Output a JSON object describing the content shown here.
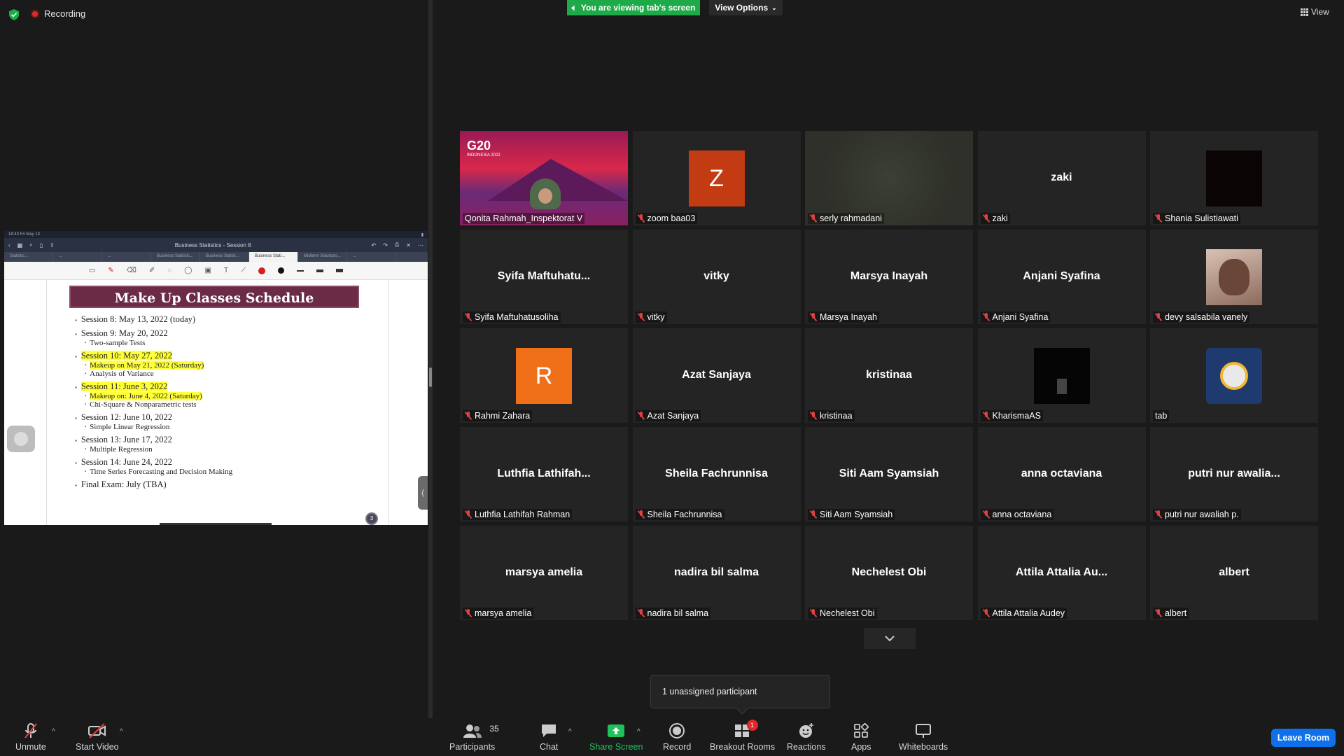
{
  "recording": {
    "label": "Recording"
  },
  "banner": {
    "viewing": "You are viewing tab's screen",
    "view_options": "View Options",
    "view": "View"
  },
  "shared": {
    "status_time": "18:43  Fri May 13",
    "doc_title": "Business Statistics - Session 8",
    "active_tab": "Business Stati...",
    "tabs": [
      "Statistic...",
      "...",
      "...",
      "Business Statistic...",
      "Business Statist...",
      "Business Stati...",
      "Midterm Solutions...",
      "..."
    ],
    "slide_title": "Make Up Classes Schedule",
    "items": [
      {
        "text": "Session 8: May 13, 2022 (today)",
        "highlight": false,
        "sub": []
      },
      {
        "text": "Session 9: May 20, 2022",
        "highlight": false,
        "sub": [
          {
            "text": "Two-sample Tests",
            "highlight": false
          }
        ]
      },
      {
        "text": "Session 10: May 27, 2022",
        "highlight": true,
        "sub": [
          {
            "text": "Makeup on May 21, 2022 (Saturday)",
            "highlight": true
          },
          {
            "text": "Analysis of Variance",
            "highlight": false
          }
        ]
      },
      {
        "text": "Session 11: June 3, 2022",
        "highlight": true,
        "sub": [
          {
            "text": "Makeup on: June 4, 2022 (Saturday)",
            "highlight": true
          },
          {
            "text": "Chi-Square & Nonparametric tests",
            "highlight": false
          }
        ]
      },
      {
        "text": "Session 12: June 10, 2022",
        "highlight": false,
        "sub": [
          {
            "text": "Simple Linear Regression",
            "highlight": false
          }
        ]
      },
      {
        "text": "Session 13: June 17, 2022",
        "highlight": false,
        "sub": [
          {
            "text": "Multiple Regression",
            "highlight": false
          }
        ]
      },
      {
        "text": "Session 14: June 24, 2022",
        "highlight": false,
        "sub": [
          {
            "text": "Time Series Forecasting and Decision Making",
            "highlight": false
          }
        ]
      },
      {
        "text": "Final Exam: July (TBA)",
        "highlight": false,
        "sub": []
      }
    ],
    "page_badge": "3"
  },
  "participants_grid": [
    {
      "name": "Qonita Rahmah_Inspektorat V",
      "big": "",
      "kind": "g20",
      "muted": false,
      "active": true,
      "g20_text": "G20",
      "g20_sub": "INDONESIA 2022"
    },
    {
      "name": "zoom baa03",
      "big": "",
      "kind": "letter",
      "letter": "Z",
      "color": "#c33b12",
      "muted": true
    },
    {
      "name": "serly rahmadani",
      "big": "",
      "kind": "video",
      "muted": true
    },
    {
      "name": "zaki",
      "big": "zaki",
      "kind": "name",
      "muted": true
    },
    {
      "name": "Shania Sulistiawati",
      "big": "",
      "kind": "black",
      "muted": true
    },
    {
      "name": "Syifa Maftuhatusoliha",
      "big": "Syifa  Maftuhatu...",
      "kind": "name",
      "muted": true
    },
    {
      "name": "vitky",
      "big": "vitky",
      "kind": "name",
      "muted": true
    },
    {
      "name": "Marsya Inayah",
      "big": "Marsya Inayah",
      "kind": "name",
      "muted": true
    },
    {
      "name": "Anjani Syafina",
      "big": "Anjani Syafina",
      "kind": "name",
      "muted": true
    },
    {
      "name": "devy salsabila vanely",
      "big": "",
      "kind": "photo-devy",
      "muted": true
    },
    {
      "name": "Rahmi Zahara",
      "big": "",
      "kind": "letter",
      "letter": "R",
      "color": "#f0701a",
      "muted": true
    },
    {
      "name": "Azat Sanjaya",
      "big": "Azat Sanjaya",
      "kind": "name",
      "muted": true
    },
    {
      "name": "kristinaa",
      "big": "kristinaa",
      "kind": "name",
      "muted": true
    },
    {
      "name": "KharismaAS",
      "big": "",
      "kind": "photo-kharisma",
      "muted": true
    },
    {
      "name": "tab",
      "big": "",
      "kind": "photo-tab",
      "muted": false
    },
    {
      "name": "Luthfia Lathifah Rahman",
      "big": "Luthfia  Lathifah...",
      "kind": "name",
      "muted": true
    },
    {
      "name": "Sheila Fachrunnisa",
      "big": "Sheila Fachrunnisa",
      "kind": "name",
      "muted": true
    },
    {
      "name": "Siti Aam Syamsiah",
      "big": "Siti Aam Syamsiah",
      "kind": "name",
      "muted": true
    },
    {
      "name": "anna octaviana",
      "big": "anna octaviana",
      "kind": "name",
      "muted": true
    },
    {
      "name": "putri nur awaliah p.",
      "big": "putri nur awalia...",
      "kind": "name",
      "muted": true
    },
    {
      "name": "marsya amelia",
      "big": "marsya amelia",
      "kind": "name",
      "muted": true
    },
    {
      "name": "nadira bil salma",
      "big": "nadira bil salma",
      "kind": "name",
      "muted": true
    },
    {
      "name": "Nechelest Obi",
      "big": "Nechelest Obi",
      "kind": "name",
      "muted": true
    },
    {
      "name": "Attila Attalia Audey",
      "big": "Attila  Attalia  Au...",
      "kind": "name",
      "muted": true
    },
    {
      "name": "albert",
      "big": "albert",
      "kind": "name",
      "muted": true
    }
  ],
  "popup": {
    "text": "1 unassigned participant"
  },
  "toolbar": {
    "unmute": "Unmute",
    "start_video": "Start Video",
    "participants": "Participants",
    "participants_count": "35",
    "chat": "Chat",
    "share_screen": "Share Screen",
    "record": "Record",
    "breakout_rooms": "Breakout Rooms",
    "breakout_badge": "1",
    "reactions": "Reactions",
    "apps": "Apps",
    "whiteboards": "Whiteboards",
    "leave": "Leave Room"
  },
  "colors": {
    "accent": "#0e71eb",
    "share_green": "#1fc15b",
    "active_border": "#f6e14b",
    "muted_red": "#e04040"
  }
}
